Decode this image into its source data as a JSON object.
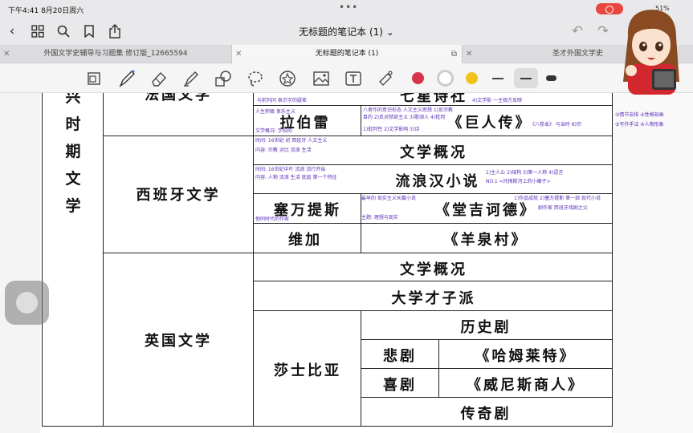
{
  "status": {
    "time": "下午4:41  8月20日周六",
    "battery": "51%"
  },
  "toolbar": {
    "title": "无标题的笔记本 (1)",
    "title_chevron": "⌄"
  },
  "tabs": [
    {
      "label": "外国文学史辅导与习题集 修订版_12665594"
    },
    {
      "label": "无标题的笔记本 (1)"
    },
    {
      "label": "圣才外国文学史"
    }
  ],
  "tools": [
    "page-layout",
    "pen",
    "eraser",
    "highlighter",
    "shape",
    "lasso",
    "sticker",
    "image",
    "text",
    "laser-pointer"
  ],
  "colors": {
    "red": "#d9334b",
    "white": "#ffffff",
    "yellow": "#f2c21b"
  },
  "table": {
    "period_chars": [
      "兴",
      "时",
      "期",
      "文",
      "学"
    ],
    "france": {
      "category": "法国文学",
      "top_cut": "七星诗社",
      "writer": "拉伯雷",
      "work": "《巨人传》"
    },
    "spain": {
      "category": "西班牙文学",
      "overview": "文学概况",
      "picaresque": "流浪汉小说",
      "cervantes": "塞万提斯",
      "cervantes_work": "《堂吉诃德》",
      "vega": "维加",
      "vega_work": "《羊泉村》"
    },
    "england": {
      "category": "英国文学",
      "overview": "文学概况",
      "university_wits": "大学才子派",
      "shakespeare": "莎士比亚",
      "history_plays": "历史剧",
      "tragedy": "悲剧",
      "tragedy_work": "《哈姆莱特》",
      "comedy": "喜剧",
      "comedy_work": "《威尼斯商人》",
      "romance": "传奇剧"
    }
  },
  "notes": {
    "n1": "与前列问 表示字的疑差",
    "n2": "4)文学影 一主观方反映",
    "n3": "人生积极 享乐主义",
    "n4": "八者作的意识形态 人文主义思想 1)反宗教",
    "n5": "目的 2)反对禁欲主义 3)歌颂人 4)批判",
    "n6": "《八卷本》 与当时 8)宗",
    "n7": "文学概况: 学校的",
    "n8": "1)批判性 2)文学影响 3)诗",
    "n9": "时间: 16世纪 初 西班牙 人文主义",
    "n10": "内容: 宗教 对比 流浪 生活",
    "n11": "时间: 16世纪中叶 流浪 流行开始",
    "n12": "内容: 人物 流浪 生活 底层 第一个特征",
    "n13": "1)主人公 2)结构 3)第一人称 4)语言",
    "n14": "NO.1 <托梅斯河上的小癞子>",
    "n15": "最早的 现实主义长篇小说",
    "n16": "他同时代的作家",
    "n17": "1)作品成就 2)塞万提斯 第一部 现代小说",
    "n18": "主题: 理想与现实",
    "n19": "剧作家 西班牙戏剧之父",
    "n20": "③情节安排 ④性格刻画",
    "n21": "③写作手法 ④人物形象"
  }
}
